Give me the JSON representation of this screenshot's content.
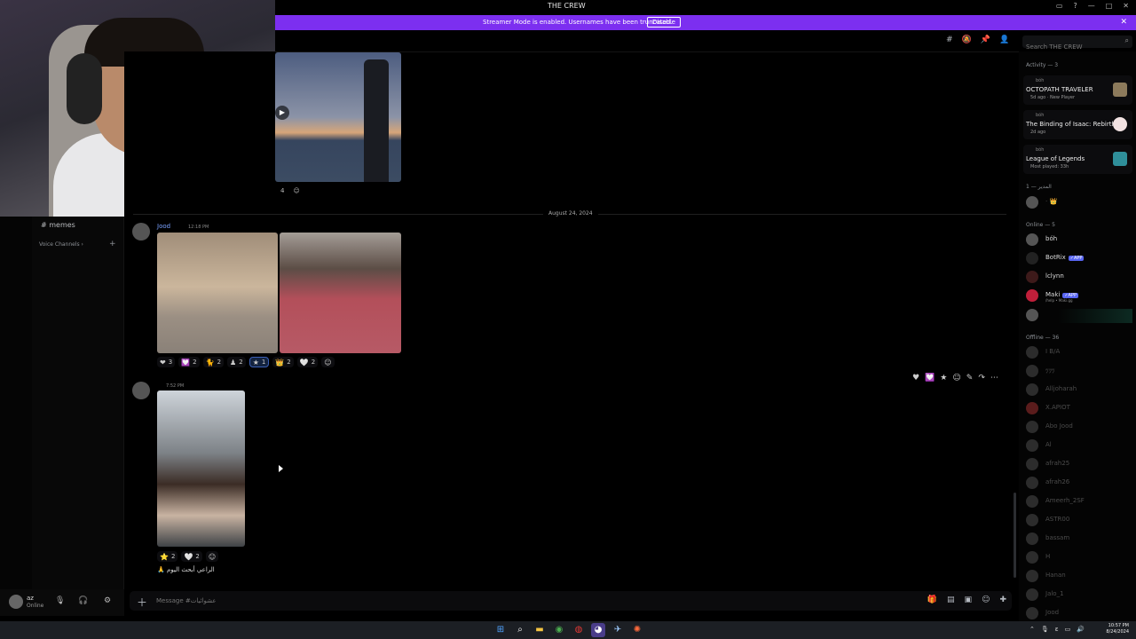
{
  "window": {
    "title": "THE CREW"
  },
  "banner": {
    "text": "Streamer Mode is enabled. Usernames have been truncated.",
    "disable_label": "Disable"
  },
  "toolbar": {
    "icons": [
      "threads-icon",
      "mute-icon",
      "pin-icon",
      "members-icon"
    ],
    "search_placeholder": "Search THE CREW"
  },
  "sidebar": {
    "channel": "# memes",
    "voice_category": "Voice Channels"
  },
  "user_panel": {
    "name": "az",
    "status": "Online"
  },
  "messages": {
    "top_reaction_count": "4",
    "date_divider": "August 24, 2024",
    "msg1": {
      "author": "Jood",
      "time": "12:18 PM",
      "reactions": [
        {
          "glyph": "❤",
          "count": "3"
        },
        {
          "glyph": "💟",
          "count": "2"
        },
        {
          "glyph": "🐈",
          "count": "2"
        },
        {
          "glyph": "♟",
          "count": "2"
        },
        {
          "glyph": "★",
          "count": "1"
        },
        {
          "glyph": "👑",
          "count": "2"
        },
        {
          "glyph": "🤍",
          "count": "2"
        }
      ]
    },
    "msg2": {
      "time": "7:52 PM",
      "reactions": [
        {
          "glyph": "⭐",
          "count": "2"
        },
        {
          "glyph": "🤍",
          "count": "2"
        }
      ],
      "caption": "🙏 الراعي أبحث اليوم"
    }
  },
  "composer": {
    "placeholder": "Message #عشوائيات"
  },
  "members": {
    "activity_header": "Activity — 3",
    "activities": [
      {
        "who": "bóh",
        "game": "OCTOPATH TRAVELER",
        "meta": "5d ago · New Player"
      },
      {
        "who": "bóh",
        "game": "The Binding of Isaac: Rebirth",
        "meta": "2d ago"
      },
      {
        "who": "bóh",
        "game": "League of Legends",
        "meta": "Most played: 33h"
      }
    ],
    "role_header": "المدير — 1",
    "online_header": "Online — 5",
    "online": [
      {
        "name": "bóh",
        "sub": ""
      },
      {
        "name": "BotRix",
        "sub": "",
        "tag": "✓APP"
      },
      {
        "name": "lclynn",
        "sub": ""
      },
      {
        "name": "Maki",
        "sub": "/help • Maki.gg",
        "tag": "✓APP"
      }
    ],
    "offline_header": "Offline — 36",
    "offline": [
      "I B/A",
      "ﾂﾂﾂ",
      "Alljoharah",
      "X.APIOT",
      "Abo Jood",
      "Al",
      "afrah25",
      "afrah26",
      "Ameerh_2SF",
      "ASTR00",
      "bassam",
      "H",
      "Hanan",
      "Jalo_1",
      "Jood"
    ]
  },
  "taskbar": {
    "time": "10:57 PM",
    "date": "8/24/2024"
  },
  "colors": {
    "banner": "#7c2ff0",
    "link": "#7aa2ff",
    "app_tag": "#5865f2"
  }
}
